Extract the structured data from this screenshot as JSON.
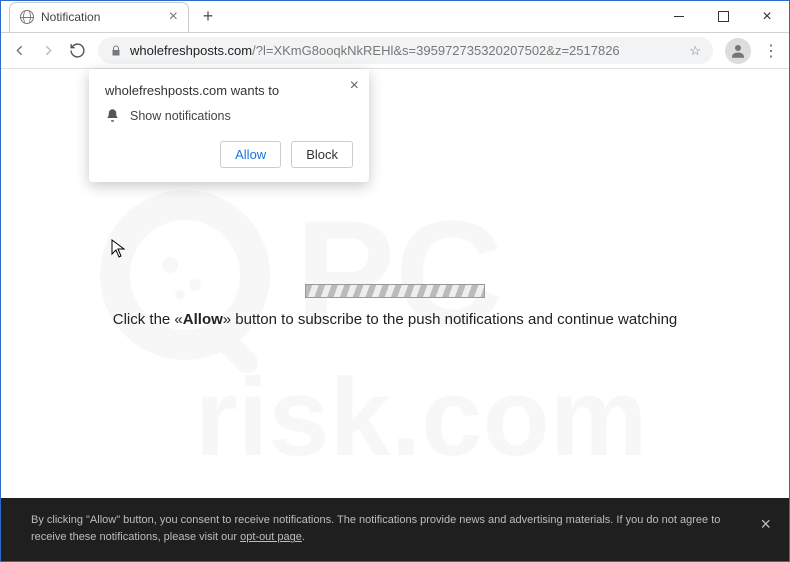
{
  "window": {
    "tab_title": "Notification"
  },
  "address": {
    "domain": "wholefreshposts.com",
    "path": "/?l=XKmG8ooqkNkREHl&s=395972735320207502&z=2517826"
  },
  "permission": {
    "title": "wholefreshposts.com wants to",
    "item": "Show notifications",
    "allow": "Allow",
    "block": "Block"
  },
  "page": {
    "msg_prefix": "Click the «",
    "msg_bold": "Allow",
    "msg_suffix": "» button to subscribe to the push notifications and continue watching"
  },
  "cookie": {
    "text": "By clicking \"Allow\" button, you consent to receive notifications. The notifications provide news and advertising materials. If you do not agree to receive these notifications, please visit our ",
    "link": "opt-out page"
  },
  "watermark": {
    "line1": "PC",
    "line2": "risk.com"
  }
}
